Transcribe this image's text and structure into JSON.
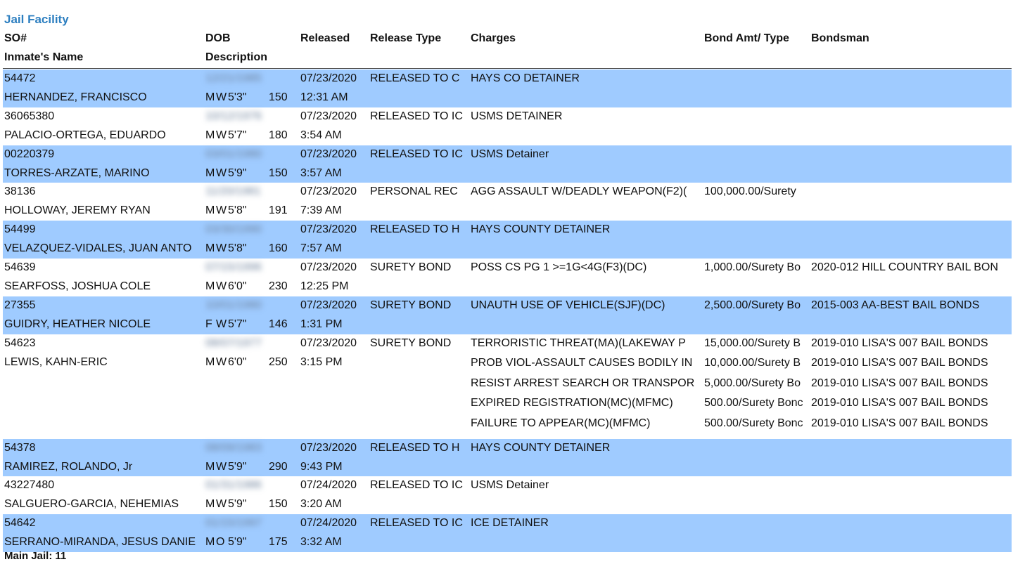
{
  "report": {
    "facility": "Jail Facility"
  },
  "headers": {
    "so": "SO#",
    "dob": "DOB",
    "released": "Released",
    "release_type": "Release Type",
    "charges": "Charges",
    "bond": "Bond Amt/ Type",
    "bondsman": "Bondsman",
    "name": "Inmate's Name",
    "description": "Description"
  },
  "inmates": [
    {
      "so": "54472",
      "name": "HERNANDEZ, FRANCISCO",
      "dob": "12/21/1985",
      "sex": "M",
      "race": "W",
      "height": "5'3\"",
      "weight": "150",
      "release_date": "07/23/2020",
      "release_time": "12:31 AM",
      "release_type": "RELEASED TO C",
      "charges": [
        {
          "charge": "HAYS CO DETAINER",
          "bond": "",
          "bondsman": ""
        }
      ]
    },
    {
      "so": "36065380",
      "name": "PALACIO-ORTEGA, EDUARDO",
      "dob": "10/12/1976",
      "sex": "M",
      "race": "W",
      "height": "5'7\"",
      "weight": "180",
      "release_date": "07/23/2020",
      "release_time": "3:54 AM",
      "release_type": "RELEASED TO IC",
      "charges": [
        {
          "charge": "USMS DETAINER",
          "bond": "",
          "bondsman": ""
        }
      ]
    },
    {
      "so": "00220379",
      "name": "TORRES-ARZATE, MARINO",
      "dob": "03/01/1980",
      "sex": "M",
      "race": "W",
      "height": "5'9\"",
      "weight": "150",
      "release_date": "07/23/2020",
      "release_time": "3:57 AM",
      "release_type": "RELEASED TO IC",
      "charges": [
        {
          "charge": "USMS Detainer",
          "bond": "",
          "bondsman": ""
        }
      ]
    },
    {
      "so": "38136",
      "name": "HOLLOWAY, JEREMY RYAN",
      "dob": "11/20/1981",
      "sex": "M",
      "race": "W",
      "height": "5'8\"",
      "weight": "191",
      "release_date": "07/23/2020",
      "release_time": "7:39 AM",
      "release_type": "PERSONAL REC",
      "charges": [
        {
          "charge": "AGG ASSAULT W/DEADLY WEAPON(F2)(",
          "bond": "100,000.00/Surety",
          "bondsman": ""
        }
      ]
    },
    {
      "so": "54499",
      "name": "VELAZQUEZ-VIDALES, JUAN ANTO",
      "dob": "03/30/1990",
      "sex": "M",
      "race": "W",
      "height": "5'8\"",
      "weight": "160",
      "release_date": "07/23/2020",
      "release_time": "7:57 AM",
      "release_type": "RELEASED TO H",
      "charges": [
        {
          "charge": "HAYS COUNTY DETAINER",
          "bond": "",
          "bondsman": ""
        }
      ]
    },
    {
      "so": "54639",
      "name": "SEARFOSS, JOSHUA COLE",
      "dob": "07/15/1996",
      "sex": "M",
      "race": "W",
      "height": "6'0\"",
      "weight": "230",
      "release_date": "07/23/2020",
      "release_time": "12:25 PM",
      "release_type": "SURETY BOND",
      "charges": [
        {
          "charge": "POSS CS PG 1 >=1G<4G(F3)(DC)",
          "bond": "1,000.00/Surety Bo",
          "bondsman": "2020-012 HILL COUNTRY BAIL BON"
        }
      ]
    },
    {
      "so": "27355",
      "name": "GUIDRY, HEATHER NICOLE",
      "dob": "10/01/1980",
      "sex": "F",
      "race": "W",
      "height": "5'7\"",
      "weight": "146",
      "release_date": "07/23/2020",
      "release_time": "1:31 PM",
      "release_type": "SURETY BOND",
      "charges": [
        {
          "charge": "UNAUTH USE OF VEHICLE(SJF)(DC)",
          "bond": "2,500.00/Surety Bo",
          "bondsman": "2015-003 AA-BEST BAIL BONDS"
        }
      ]
    },
    {
      "so": "54623",
      "name": "LEWIS, KAHN-ERIC",
      "dob": "08/07/1977",
      "sex": "M",
      "race": "W",
      "height": "6'0\"",
      "weight": "250",
      "release_date": "07/23/2020",
      "release_time": "3:15 PM",
      "release_type": "SURETY BOND",
      "charges": [
        {
          "charge": "TERRORISTIC THREAT(MA)(LAKEWAY P",
          "bond": "15,000.00/Surety B",
          "bondsman": "2019-010 LISA'S 007 BAIL BONDS"
        },
        {
          "charge": "PROB VIOL-ASSAULT CAUSES BODILY IN",
          "bond": "10,000.00/Surety B",
          "bondsman": "2019-010 LISA'S 007 BAIL BONDS"
        },
        {
          "charge": "RESIST ARREST SEARCH OR TRANSPOR",
          "bond": "5,000.00/Surety Bo",
          "bondsman": "2019-010 LISA'S 007 BAIL BONDS"
        },
        {
          "charge": "EXPIRED  REGISTRATION(MC)(MFMC)",
          "bond": "500.00/Surety Bonc",
          "bondsman": "2019-010 LISA'S 007 BAIL BONDS"
        },
        {
          "charge": "FAILURE TO APPEAR(MC)(MFMC)",
          "bond": "500.00/Surety Bonc",
          "bondsman": "2019-010 LISA'S 007 BAIL BONDS"
        }
      ]
    },
    {
      "so": "54378",
      "name": "RAMIREZ, ROLANDO, Jr",
      "dob": "08/09/1983",
      "sex": "M",
      "race": "W",
      "height": "5'9\"",
      "weight": "290",
      "release_date": "07/23/2020",
      "release_time": "9:43 PM",
      "release_type": "RELEASED TO H",
      "charges": [
        {
          "charge": "HAYS COUNTY DETAINER",
          "bond": "",
          "bondsman": ""
        }
      ]
    },
    {
      "so": "43227480",
      "name": "SALGUERO-GARCIA, NEHEMIAS",
      "dob": "01/31/1986",
      "sex": "M",
      "race": "W",
      "height": "5'9\"",
      "weight": "150",
      "release_date": "07/24/2020",
      "release_time": "3:20 AM",
      "release_type": "RELEASED TO IC",
      "charges": [
        {
          "charge": "USMS Detainer",
          "bond": "",
          "bondsman": ""
        }
      ]
    },
    {
      "so": "54642",
      "name": "SERRANO-MIRANDA, JESUS DANIE",
      "dob": "01/15/1997",
      "sex": "M",
      "race": "O",
      "height": "5'9\"",
      "weight": "175",
      "release_date": "07/24/2020",
      "release_time": "3:32 AM",
      "release_type": "RELEASED TO IC",
      "charges": [
        {
          "charge": "ICE DETAINER",
          "bond": "",
          "bondsman": ""
        }
      ]
    }
  ],
  "footer": {
    "label": "Main Jail:",
    "count": "11"
  }
}
